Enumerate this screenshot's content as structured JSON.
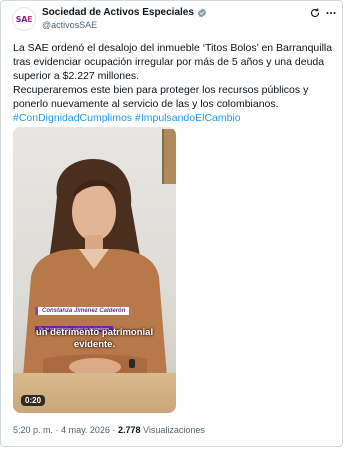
{
  "account": {
    "avatar_text_a": "SA",
    "avatar_text_b": "E",
    "display_name": "Sociedad de Activos Especiales",
    "handle": "@activosSAE",
    "verified_color": "#829aab"
  },
  "tweet": {
    "paragraph_1": "La SAE ordenó el desalojo del inmueble ‘Titos Bolos’ en Barranquilla tras evidenciar ocupación irregular por más de 5 años y una deuda superior a $2.227 millones.",
    "paragraph_2": "Recuperaremos este bien para proteger los recursos públicos y ponerlo nuevamente al servicio de las y los colombianos.",
    "hashtag_1": "#ConDignidadCumplimos",
    "hashtag_2": "#ImpulsandoElCambio"
  },
  "video": {
    "lower_third_name": "Constanza Jiménez Calderón",
    "lower_third_role": "Dir. de seguimiento y control de liquidaciones",
    "caption_line_1": "un detrimento patrimonial",
    "caption_line_2": "evidente.",
    "duration": "0:20"
  },
  "meta": {
    "time": "5:20 p. m.",
    "separator": "·",
    "date": "4 may. 2026",
    "views_count": "2.778",
    "views_label": "Visualizaciones"
  },
  "icons": {
    "refresh": "refresh-icon",
    "more": "more-options-icon",
    "verified": "verified-badge-icon"
  },
  "colors": {
    "hashtag": "#1d9bf0",
    "secondary_text": "#536471",
    "brand_purple": "#6b2c8f"
  }
}
